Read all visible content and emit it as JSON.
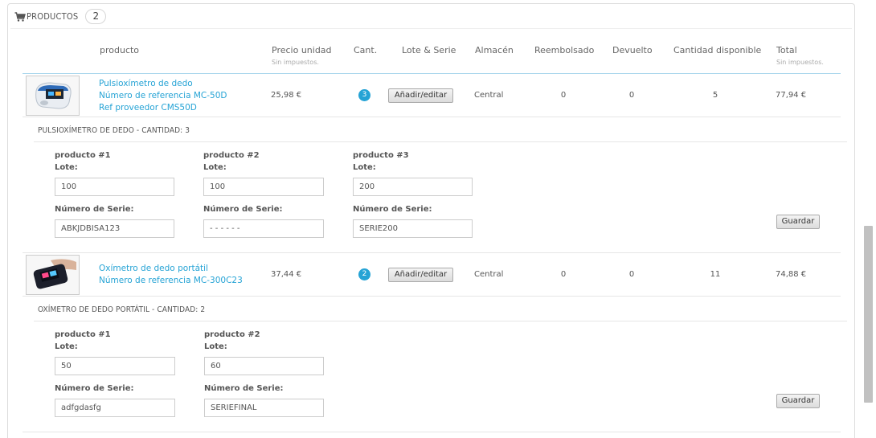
{
  "panel": {
    "title": "PRODUCTOS",
    "count": "2",
    "icon": "shopping-cart-icon"
  },
  "columns": {
    "product": "producto",
    "unit_price": "Precio unidad",
    "unit_price_note": "Sin impuestos.",
    "qty": "Cant.",
    "lot_serial": "Lote & Serie",
    "warehouse": "Almacén",
    "refunded": "Reembolsado",
    "returned": "Devuelto",
    "available": "Cantidad disponible",
    "total": "Total",
    "total_note": "Sin impuestos."
  },
  "products": [
    {
      "name": "Pulsioxímetro de dedo",
      "reference": "Número de referencia MC-50D",
      "supplier_ref": "Ref proveedor CMS50D",
      "unit_price": "25,98 €",
      "qty": "3",
      "edit_label": "Añadir/editar",
      "warehouse": "Central",
      "refunded": "0",
      "returned": "0",
      "available": "5",
      "total": "77,94 €",
      "section_title": "PULSIOXÍMETRO DE DEDO - CANTIDAD: 3",
      "units": [
        {
          "title": "producto #1",
          "lot_label": "Lote:",
          "lot": "100",
          "serial_label": "Número de Serie:",
          "serial": "ABKJDBISA123"
        },
        {
          "title": "producto #2",
          "lot_label": "Lote:",
          "lot": "100",
          "serial_label": "Número de Serie:",
          "serial": "- - - - - -"
        },
        {
          "title": "producto #3",
          "lot_label": "Lote:",
          "lot": "200",
          "serial_label": "Número de Serie:",
          "serial": "SERIE200"
        }
      ],
      "save_label": "Guardar"
    },
    {
      "name": "Oxímetro de dedo portátil",
      "reference": "Número de referencia MC-300C23",
      "unit_price": "37,44 €",
      "qty": "2",
      "edit_label": "Añadir/editar",
      "warehouse": "Central",
      "refunded": "0",
      "returned": "0",
      "available": "11",
      "total": "74,88 €",
      "section_title": "OXÍMETRO DE DEDO PORTÁTIL - CANTIDAD: 2",
      "units": [
        {
          "title": "producto #1",
          "lot_label": "Lote:",
          "lot": "50",
          "serial_label": "Número de Serie:",
          "serial": "adfgdasfg"
        },
        {
          "title": "producto #2",
          "lot_label": "Lote:",
          "lot": "60",
          "serial_label": "Número de Serie:",
          "serial": "SERIEFINAL"
        }
      ],
      "save_label": "Guardar"
    }
  ],
  "colors": {
    "accent": "#25a3d5",
    "border": "#dcdcdc"
  }
}
